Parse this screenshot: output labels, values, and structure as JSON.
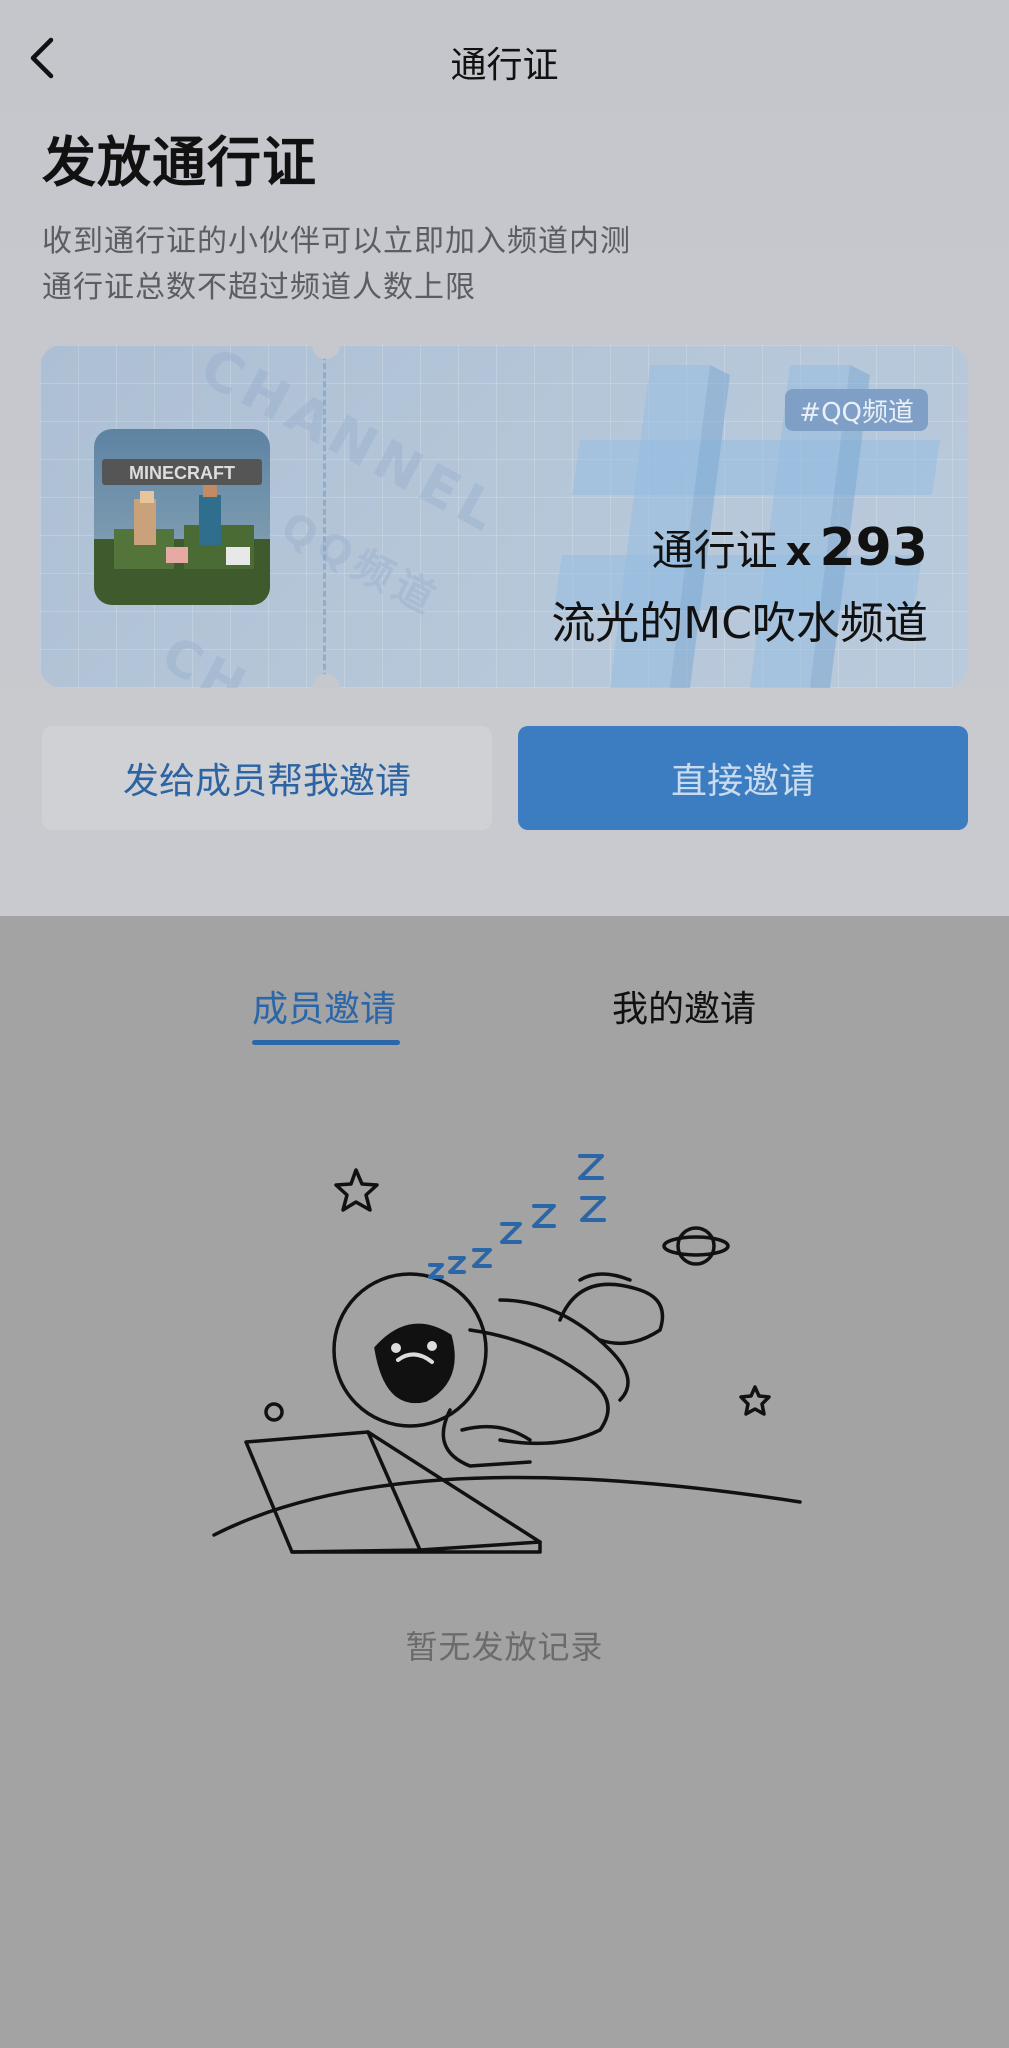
{
  "nav": {
    "title": "通行证",
    "back_icon": "chevron-left-icon"
  },
  "header": {
    "title": "发放通行证",
    "subtitle_line1": "收到通行证的小伙伴可以立即加入频道内测",
    "subtitle_line2": "通行证总数不超过频道人数上限"
  },
  "pass_card": {
    "badge": "#QQ频道",
    "pass_label": "通行证",
    "multiplier": "x",
    "count": "293",
    "channel_name": "流光的MC吹水频道",
    "game_icon_text": "MINECRAFT",
    "watermark_1": "CHANNEL",
    "watermark_2": "QQ频道",
    "watermark_3": "CH"
  },
  "actions": {
    "secondary_label": "发给成员帮我邀请",
    "primary_label": "直接邀请"
  },
  "tabs": [
    {
      "label": "成员邀请",
      "active": true
    },
    {
      "label": "我的邀请",
      "active": false
    }
  ],
  "empty_state": {
    "message": "暂无发放记录",
    "illustration": "sleeping-astronaut-laptop"
  },
  "colors": {
    "accent": "#3c7cc0",
    "accent_text": "#2b66a8",
    "card_bg": "#b6c7d9"
  }
}
